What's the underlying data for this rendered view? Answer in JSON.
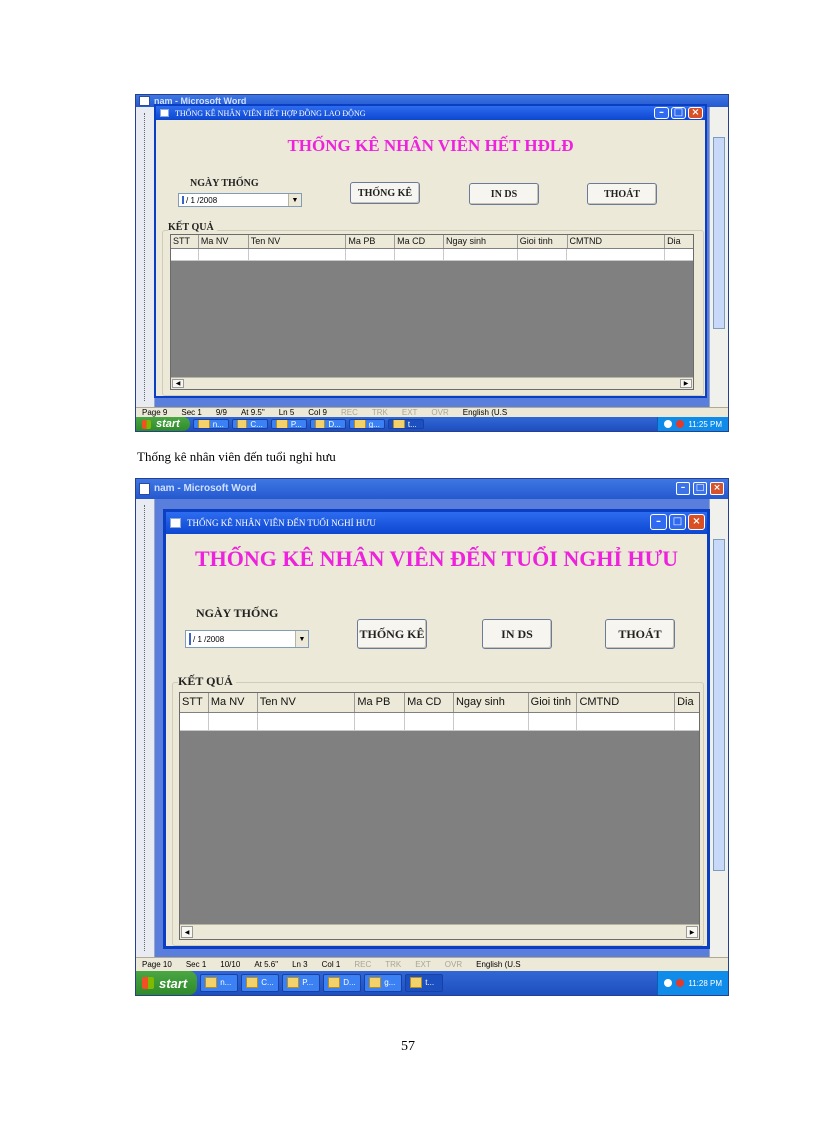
{
  "screenshots": [
    {
      "word_title": "nam - Microsoft Word",
      "dialog_title": "THỐNG KÊ NHÂN VIÊN HẾT HỢP ĐỒNG LAO ĐỘNG",
      "heading": "THỐNG KÊ NHÂN VIÊN HẾT HĐLĐ",
      "date_label": "NGÀY THỐNG",
      "date_value": "/ 1 /2008",
      "buttons": [
        "THỐNG KÊ",
        "IN DS",
        "THOÁT"
      ],
      "result_label": "KẾT QUẢ",
      "columns": [
        "STT",
        "Ma NV",
        "Ten NV",
        "Ma PB",
        "Ma CD",
        "Ngay sinh",
        "Gioi tinh",
        "CMTND",
        "Dia"
      ],
      "status": {
        "page": "Page 9",
        "sec": "Sec 1",
        "pages": "9/9",
        "at": "At 9.5\"",
        "ln": "Ln 5",
        "col": "Col 9",
        "flags": [
          "REC",
          "TRK",
          "EXT",
          "OVR"
        ],
        "lang": "English (U.S"
      },
      "taskbar": {
        "start": "start",
        "tasks": [
          "n...",
          "C...",
          "P...",
          "D...",
          "g...",
          "t..."
        ],
        "clock": "11:25 PM"
      }
    },
    {
      "word_title": "nam - Microsoft Word",
      "dialog_title": "THỐNG KÊ NHÂN VIÊN ĐẾN TUỔI NGHỈ HƯU",
      "heading": "THỐNG KÊ NHÂN VIÊN ĐẾN TUỔI NGHỈ HƯU",
      "date_label": "NGÀY THỐNG",
      "date_value": "/ 1 /2008",
      "buttons": [
        "THỐNG KÊ",
        "IN DS",
        "THOÁT"
      ],
      "result_label": "KẾT QUẢ",
      "columns": [
        "STT",
        "Ma NV",
        "Ten NV",
        "Ma PB",
        "Ma CD",
        "Ngay sinh",
        "Gioi tinh",
        "CMTND",
        "Dia"
      ],
      "status": {
        "page": "Page 10",
        "sec": "Sec 1",
        "pages": "10/10",
        "at": "At 5.6\"",
        "ln": "Ln 3",
        "col": "Col 1",
        "flags": [
          "REC",
          "TRK",
          "EXT",
          "OVR"
        ],
        "lang": "English (U.S"
      },
      "taskbar": {
        "start": "start",
        "tasks": [
          "n...",
          "C...",
          "P...",
          "D...",
          "g...",
          "t..."
        ],
        "clock": "11:28 PM"
      }
    }
  ],
  "caption": "Thống kê nhân viên đến tuổi nghỉ hưu",
  "page_number": "57"
}
